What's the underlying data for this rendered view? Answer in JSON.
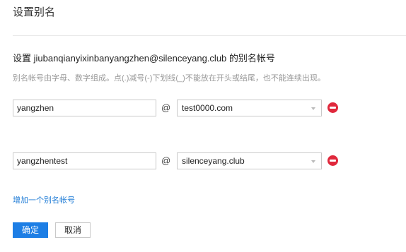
{
  "page": {
    "title": "设置别名"
  },
  "form": {
    "heading": "设置 jiubanqianyixinbanyangzhen@silenceyang.club 的别名帐号",
    "hint": "别名帐号由字母、数字组成。点(.)减号(-)下划线(_)不能放在开头或结尾，也不能连续出现。",
    "at_symbol": "@",
    "aliases": [
      {
        "name": "yangzhen",
        "domain": "test0000.com"
      },
      {
        "name": "yangzhentest",
        "domain": "silenceyang.club"
      }
    ],
    "add_link": "增加一个别名帐号"
  },
  "actions": {
    "confirm_label": "确定",
    "cancel_label": "取消"
  },
  "colors": {
    "primary": "#1d7ee5",
    "link": "#1e7bd6",
    "remove": "#e0283c",
    "hint": "#999999"
  },
  "icons": {
    "remove": "minus-circle-icon",
    "dropdown": "caret-down-icon"
  }
}
